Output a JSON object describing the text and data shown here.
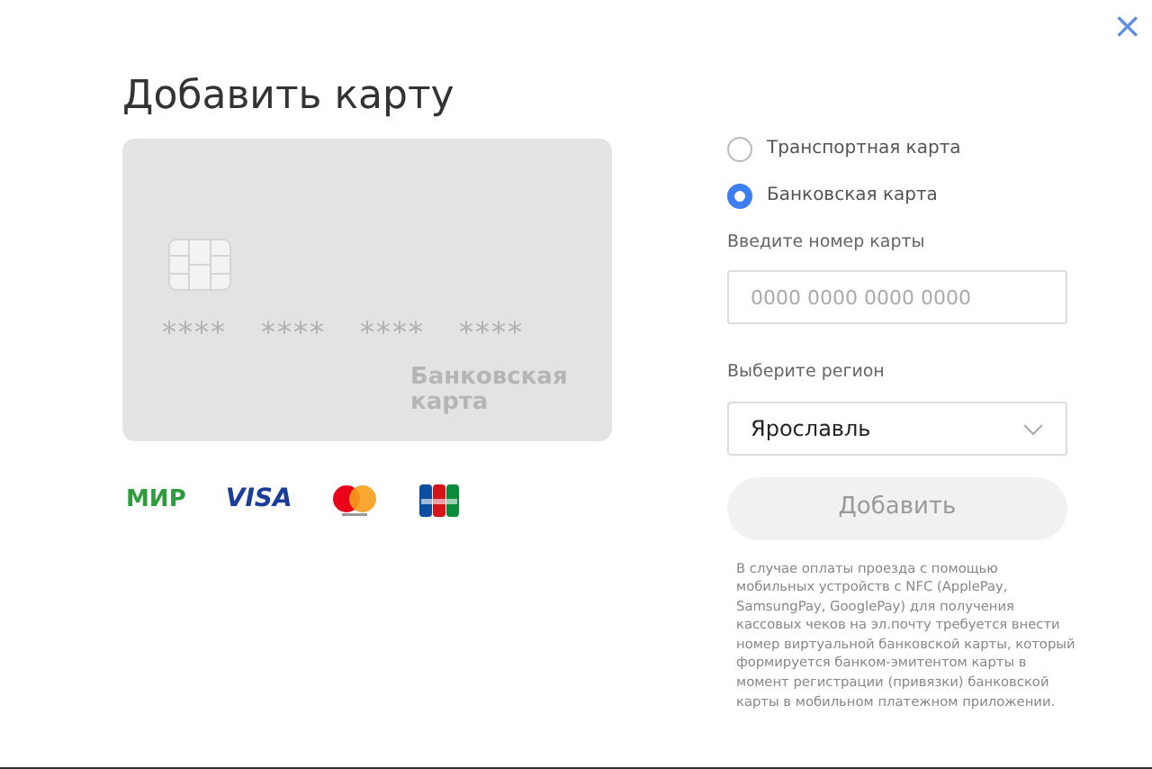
{
  "close_symbol": "×",
  "title": "Добавить карту",
  "card_preview": {
    "number_groups": [
      "****",
      "****",
      "****",
      "****"
    ],
    "label": "Банковская карта"
  },
  "payment_systems": [
    {
      "kind": "mir",
      "text": "МИР"
    },
    {
      "kind": "visa",
      "text": "VISA"
    },
    {
      "kind": "mastercard"
    },
    {
      "kind": "jcb"
    }
  ],
  "card_types": [
    {
      "label": "Транспортная карта",
      "selected": false
    },
    {
      "label": "Банковская карта",
      "selected": true
    }
  ],
  "card_number": {
    "label": "Введите номер карты",
    "placeholder": "0000 0000 0000 0000"
  },
  "region": {
    "label": "Выберите регион",
    "value": "Ярославль"
  },
  "add_button": {
    "label": "Добавить",
    "disabled": true
  },
  "note": "В случае оплаты проезда с помощью мобильных устройств с NFC (ApplePay, SamsungPay, GooglePay) для получения кассовых чеков на эл.почту требуется внести номер виртуальной банковской карты, который формируется банком-эмитентом карты в момент регистрации (привязки) банковской карты в мобильном платежном приложении."
}
